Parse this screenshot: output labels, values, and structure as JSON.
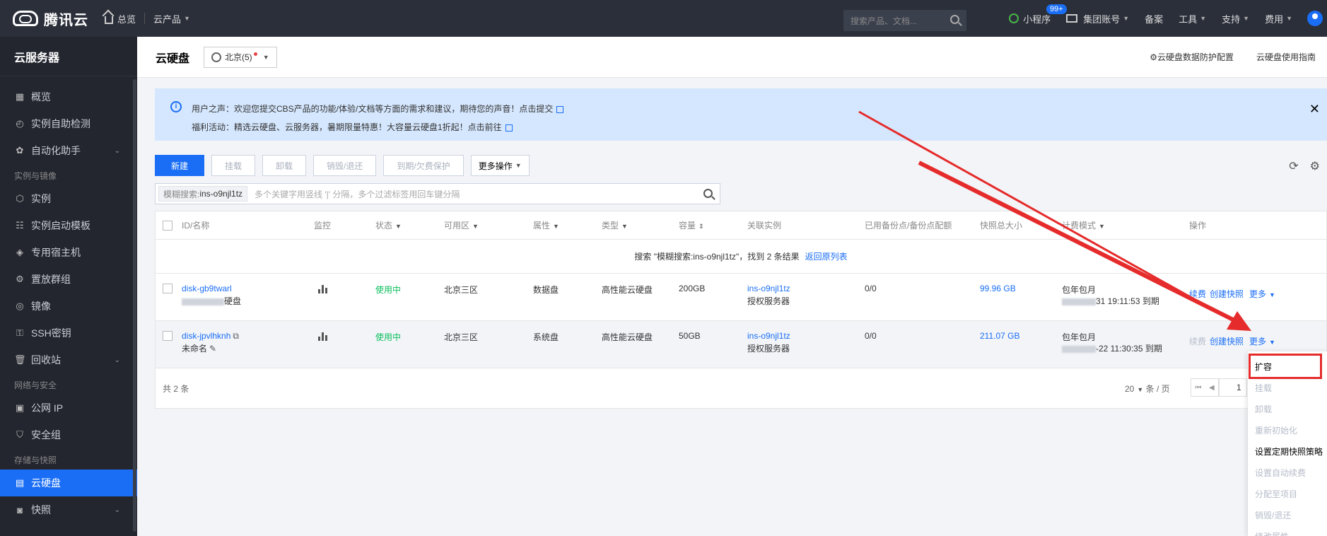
{
  "topbar": {
    "brand": "腾讯云",
    "overview": "总览",
    "products": "云产品",
    "search_placeholder": "搜索产品、文档...",
    "miniprogram": "小程序",
    "mail_badge": "99+",
    "group_account": "集团账号",
    "filing": "备案",
    "tools": "工具",
    "support": "支持",
    "cost": "费用"
  },
  "sidebar": {
    "title": "云服务器",
    "overview": "概览",
    "self_check": "实例自助检测",
    "automation": "自动化助手",
    "group_instances": "实例与镜像",
    "instances": "实例",
    "launch_template": "实例启动模板",
    "dedicated_host": "专用宿主机",
    "placement_group": "置放群组",
    "images": "镜像",
    "ssh_keys": "SSH密钥",
    "recycle_bin": "回收站",
    "group_network": "网络与安全",
    "public_ip": "公网 IP",
    "security_group": "安全组",
    "group_storage": "存储与快照",
    "cloud_disk": "云硬盘",
    "snapshots": "快照"
  },
  "header": {
    "title": "云硬盘",
    "region": "北京(5)",
    "protect_config": "云硬盘数据防护配置",
    "guide": "云硬盘使用指南"
  },
  "notice": {
    "line1": "用户之声：欢迎您提交CBS产品的功能/体验/文档等方面的需求和建议，期待您的声音！点击提交",
    "line2": "福利活动：精选云硬盘、云服务器，暑期限量特惠！大容量云硬盘1折起！点击前往"
  },
  "toolbar": {
    "create": "新建",
    "mount": "挂载",
    "unmount": "卸载",
    "destroy": "销毁/退还",
    "expire": "到期/欠费保护",
    "more": "更多操作"
  },
  "search": {
    "tag_key": "模糊搜索:",
    "tag_value": "ins-o9njl1tz",
    "placeholder": "多个关键字用竖线 '|' 分隔，多个过滤标签用回车键分隔"
  },
  "table": {
    "headers": {
      "id": "ID/名称",
      "monitor": "监控",
      "status": "状态",
      "zone": "可用区",
      "attr": "属性",
      "type": "类型",
      "capacity": "容量",
      "instance": "关联实例",
      "backup": "已用备份点/备份点配额",
      "snapshot": "快照总大小",
      "billing": "计费模式",
      "ops": "操作"
    },
    "result_prefix": "搜索 \"模糊搜索:ins-o9njl1tz\"，找到 2 条结果",
    "result_back": "返回原列表",
    "rows": [
      {
        "id": "disk-gb9twarl",
        "name": "硬盘",
        "status": "使用中",
        "zone": "北京三区",
        "attr": "数据盘",
        "type": "高性能云硬盘",
        "capacity": "200GB",
        "instance": "ins-o9njl1tz",
        "instance_sub": "授权服务器",
        "backup": "0/0",
        "snapshot": "99.96 GB",
        "billing": "包年包月",
        "expire": "31 19:11:53 到期",
        "op_renew": "续费",
        "op_snapshot": "创建快照",
        "op_more": "更多"
      },
      {
        "id": "disk-jpvlhknh",
        "name": "未命名",
        "status": "使用中",
        "zone": "北京三区",
        "attr": "系统盘",
        "type": "高性能云硬盘",
        "capacity": "50GB",
        "instance": "ins-o9njl1tz",
        "instance_sub": "授权服务器",
        "backup": "0/0",
        "snapshot": "211.07 GB",
        "billing": "包年包月",
        "expire": "-22 11:30:35 到期",
        "op_renew": "续费",
        "op_snapshot": "创建快照",
        "op_more": "更多"
      }
    ],
    "total": "共 2 条",
    "page_size": "20",
    "per_page": "条 / 页",
    "page": "1"
  },
  "dropdown": {
    "items": [
      "扩容",
      "挂载",
      "卸载",
      "重新初始化",
      "设置定期快照策略",
      "设置自动续费",
      "分配至项目",
      "销毁/退还",
      "修改属性"
    ]
  },
  "colors": {
    "primary": "#1a6ef5",
    "topbar": "#2b2f3a",
    "sidebar": "#23262f",
    "status_green": "#0abf5b",
    "annotation_red": "#e52b2b"
  }
}
